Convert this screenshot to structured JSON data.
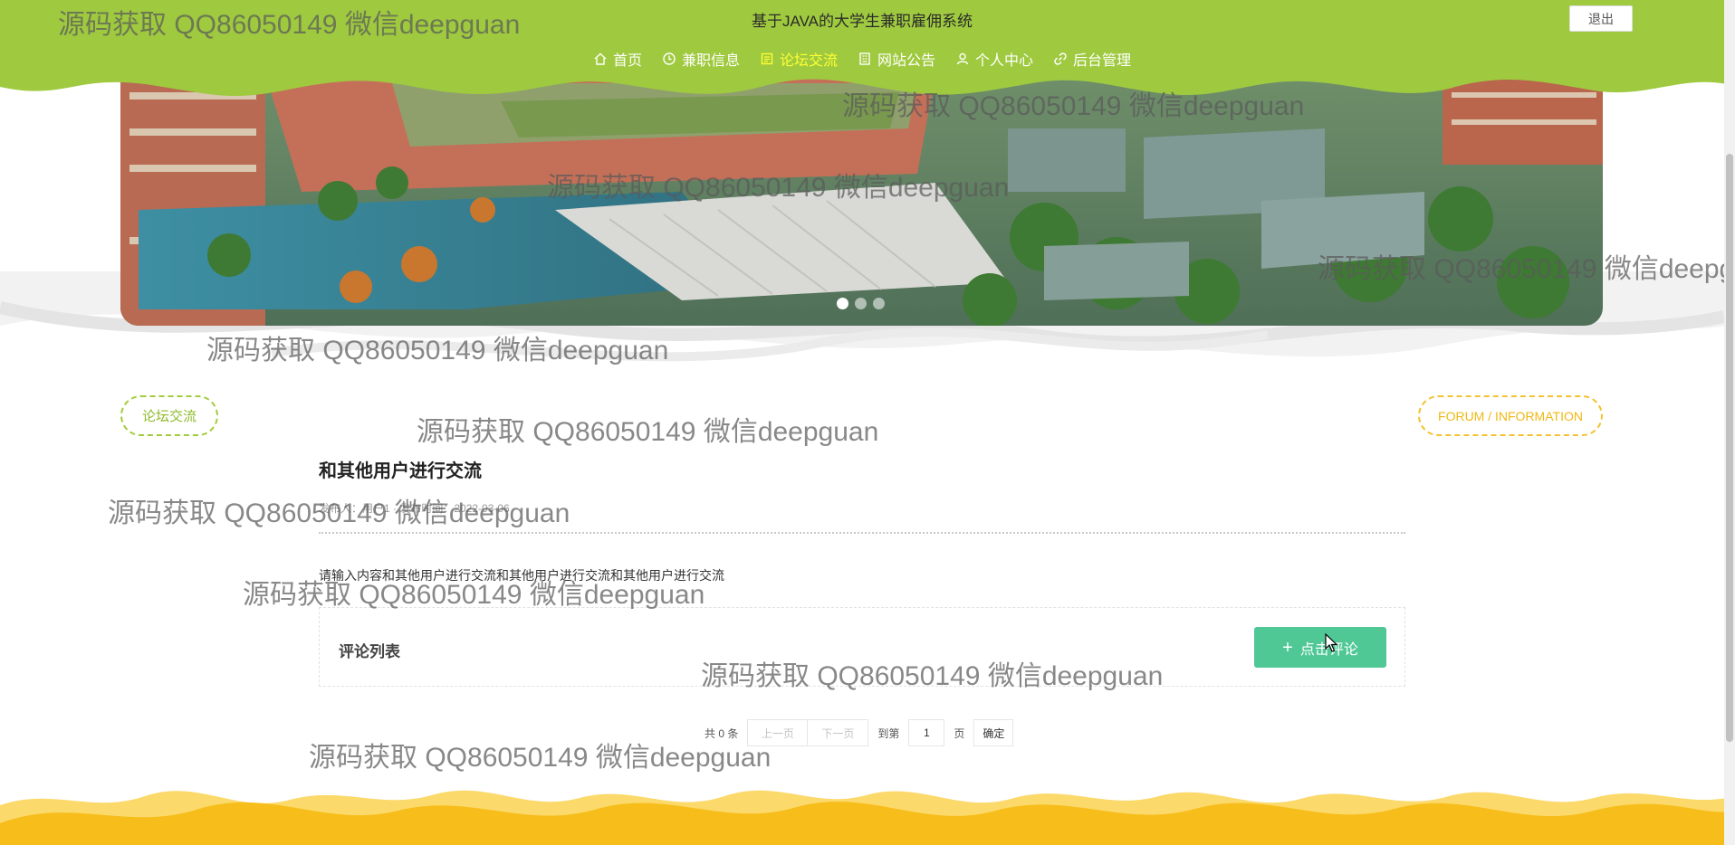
{
  "header": {
    "site_title": "基于JAVA的大学生兼职雇佣系统",
    "logout_label": "退出",
    "nav": [
      {
        "label": "首页",
        "icon": "home-icon",
        "active": false
      },
      {
        "label": "兼职信息",
        "icon": "clock-icon",
        "active": false
      },
      {
        "label": "论坛交流",
        "icon": "forum-icon",
        "active": true
      },
      {
        "label": "网站公告",
        "icon": "notice-icon",
        "active": false
      },
      {
        "label": "个人中心",
        "icon": "user-icon",
        "active": false
      },
      {
        "label": "后台管理",
        "icon": "link-icon",
        "active": false
      }
    ]
  },
  "carousel": {
    "slide_count": 3,
    "active_index": 0
  },
  "section": {
    "tag_left": "论坛交流",
    "tag_right": "FORUM / INFORMATION"
  },
  "post": {
    "title": "和其他用户进行交流",
    "meta": "发布人：用户1 · 发布时间：2022-03-06",
    "content": "请输入内容和其他用户进行交流和其他用户进行交流和其他用户进行交流"
  },
  "comments": {
    "title": "评论列表",
    "add_button": "点击评论"
  },
  "pager": {
    "total": "共 0 条",
    "prev": "上一页",
    "next": "下一页",
    "goto_prefix": "到第",
    "page_value": "1",
    "page_suffix": "页",
    "confirm": "确定"
  },
  "watermark": "源码获取 QQ86050149 微信deepguan",
  "colors": {
    "header_green": "#9fca3f",
    "active_nav": "#ffff33",
    "button_green": "#4fc896",
    "footer_yellow": "#f7bd1a"
  }
}
